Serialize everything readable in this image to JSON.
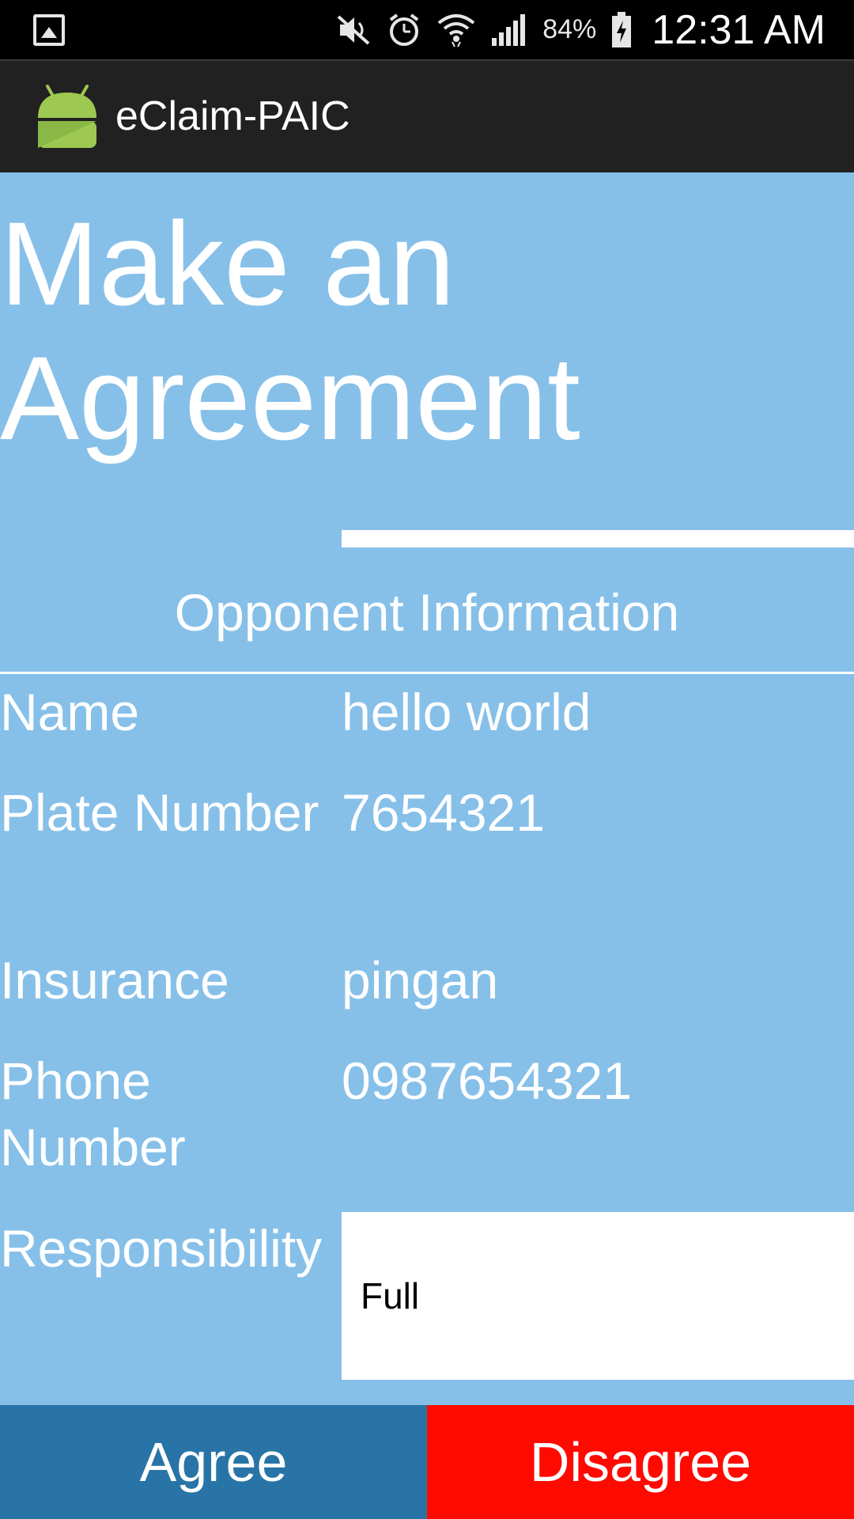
{
  "status_bar": {
    "battery_percent": "84%",
    "time": "12:31 AM",
    "icons": [
      "gallery-icon",
      "mute-icon",
      "alarm-icon",
      "wifi-icon",
      "signal-icon",
      "battery-charging-icon"
    ]
  },
  "app_bar": {
    "title": "eClaim-PAIC",
    "logo": "android-icon"
  },
  "main": {
    "headline": "Make an Agreement",
    "section_title": "Opponent Information",
    "rows": [
      {
        "label": "Name",
        "value": "hello world"
      },
      {
        "label": "Plate Number",
        "value": "7654321"
      },
      {
        "label": "Insurance",
        "value": "pingan"
      },
      {
        "label": "Phone Number",
        "value": "0987654321"
      }
    ],
    "responsibility": {
      "label": "Responsibility",
      "value": "Full"
    }
  },
  "buttons": {
    "agree": "Agree",
    "disagree": "Disagree"
  },
  "colors": {
    "background": "#86c0e9",
    "agree": "#2874a6",
    "disagree": "#ff0a00",
    "app_bar": "#212121"
  }
}
